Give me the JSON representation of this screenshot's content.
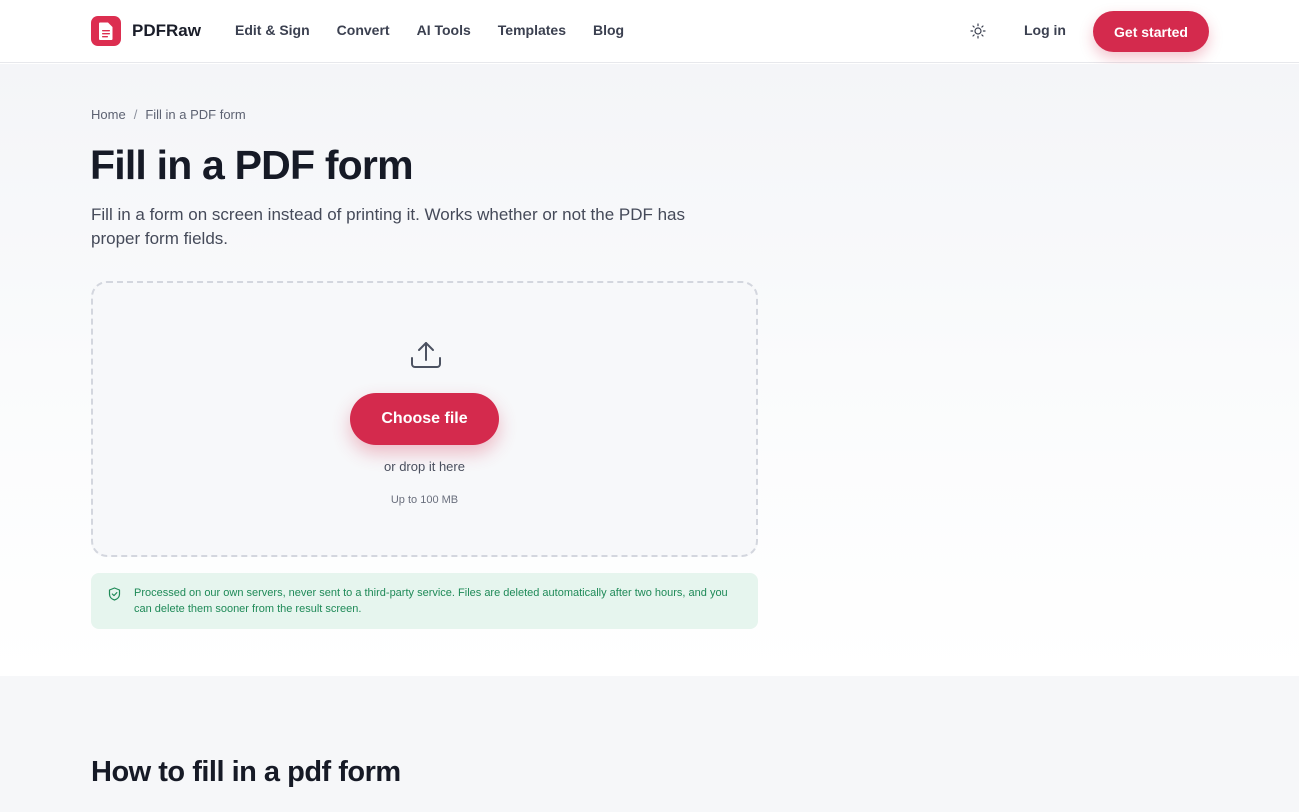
{
  "header": {
    "brand": "PDFRaw",
    "nav": [
      "Edit & Sign",
      "Convert",
      "AI Tools",
      "Templates",
      "Blog"
    ],
    "login_label": "Log in",
    "cta_label": "Get started"
  },
  "hero": {
    "breadcrumb": {
      "home": "Home",
      "separator": "/",
      "current": "Fill in a PDF form"
    },
    "title": "Fill in a PDF form",
    "subtitle": "Fill in a form on screen instead of printing it. Works whether or not the PDF has proper form fields."
  },
  "upload": {
    "icon": "upload-icon",
    "button_label": "Choose file",
    "drop_hint": "or drop it here",
    "size_limit": "Up to 100 MB"
  },
  "privacy": {
    "icon": "shield-check-icon",
    "text": "Processed on our own servers, never sent to a third-party service. Files are deleted automatically after two hours, and you can delete them sooner from the result screen."
  },
  "howto": {
    "title": "How to fill in a pdf form"
  },
  "colors": {
    "brand": "#d42a4d",
    "privacy_bg": "#e6f5ee",
    "privacy_text": "#1f8a58"
  }
}
